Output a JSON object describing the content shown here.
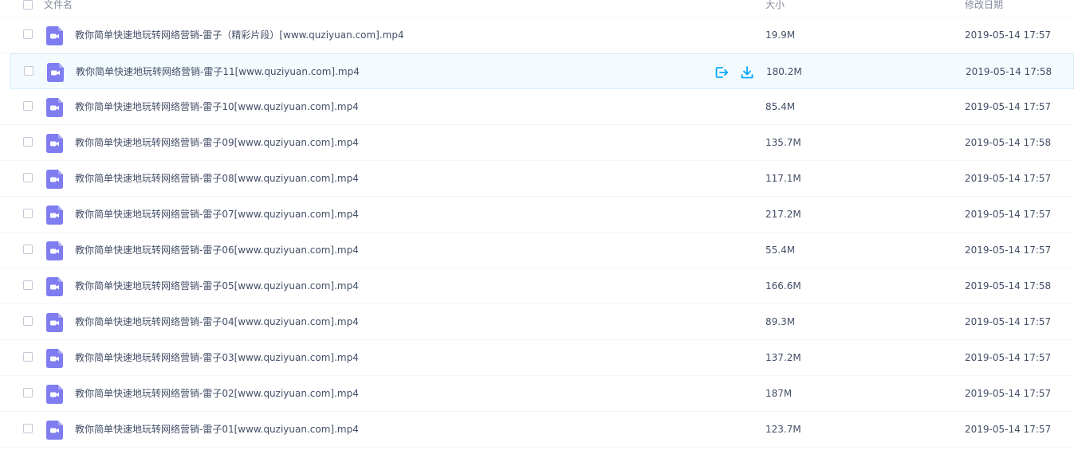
{
  "header": {
    "name_label": "文件名",
    "size_label": "大小",
    "date_label": "修改日期"
  },
  "colors": {
    "video_icon": "#7f7df0",
    "action_icon": "#06a7ff",
    "hover_row_bg": "#f4fbff"
  },
  "icons": {
    "file": "video-file-icon",
    "share": "share-icon",
    "download": "download-icon"
  },
  "rows": [
    {
      "name": "教你简单快速地玩转网络营销-雷子（精彩片段）[www.quziyuan.com].mp4",
      "size": "19.9M",
      "date": "2019-05-14 17:57"
    },
    {
      "name": "教你简单快速地玩转网络营销-雷子11[www.quziyuan.com].mp4",
      "size": "180.2M",
      "date": "2019-05-14 17:58"
    },
    {
      "name": "教你简单快速地玩转网络营销-雷子10[www.quziyuan.com].mp4",
      "size": "85.4M",
      "date": "2019-05-14 17:57"
    },
    {
      "name": "教你简单快速地玩转网络营销-雷子09[www.quziyuan.com].mp4",
      "size": "135.7M",
      "date": "2019-05-14 17:58"
    },
    {
      "name": "教你简单快速地玩转网络营销-雷子08[www.quziyuan.com].mp4",
      "size": "117.1M",
      "date": "2019-05-14 17:57"
    },
    {
      "name": "教你简单快速地玩转网络营销-雷子07[www.quziyuan.com].mp4",
      "size": "217.2M",
      "date": "2019-05-14 17:57"
    },
    {
      "name": "教你简单快速地玩转网络营销-雷子06[www.quziyuan.com].mp4",
      "size": "55.4M",
      "date": "2019-05-14 17:57"
    },
    {
      "name": "教你简单快速地玩转网络营销-雷子05[www.quziyuan.com].mp4",
      "size": "166.6M",
      "date": "2019-05-14 17:58"
    },
    {
      "name": "教你简单快速地玩转网络营销-雷子04[www.quziyuan.com].mp4",
      "size": "89.3M",
      "date": "2019-05-14 17:57"
    },
    {
      "name": "教你简单快速地玩转网络营销-雷子03[www.quziyuan.com].mp4",
      "size": "137.2M",
      "date": "2019-05-14 17:57"
    },
    {
      "name": "教你简单快速地玩转网络营销-雷子02[www.quziyuan.com].mp4",
      "size": "187M",
      "date": "2019-05-14 17:57"
    },
    {
      "name": "教你简单快速地玩转网络营销-雷子01[www.quziyuan.com].mp4",
      "size": "123.7M",
      "date": "2019-05-14 17:57"
    }
  ]
}
